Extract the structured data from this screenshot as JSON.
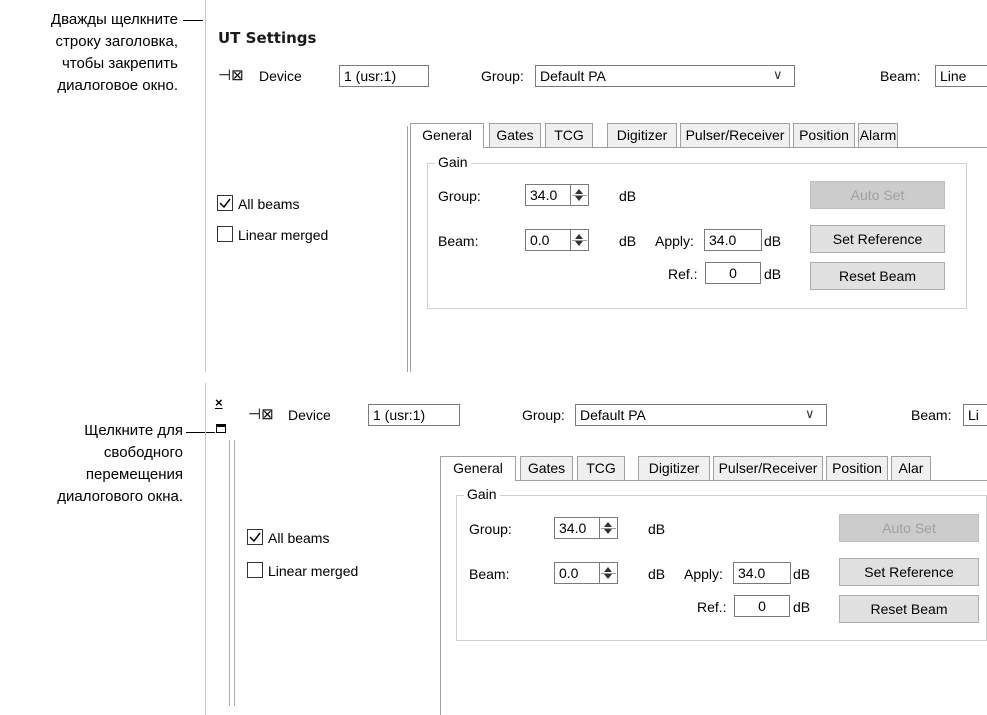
{
  "callouts": {
    "top": [
      "Дважды щелкните",
      "строку заголовка,",
      "чтобы закрепить",
      "диалоговое окно."
    ],
    "bottom": [
      "Щелкните для",
      "свободного",
      "перемещения",
      "диалогового окна."
    ]
  },
  "window": {
    "title": "UT Settings"
  },
  "toolbar": {
    "device_label": "Device",
    "device_value": "1 (usr:1)",
    "group_label": "Group:",
    "group_value": "Default PA",
    "beam_label": "Beam:",
    "beam_value_top": "Line",
    "beam_value_bottom": "Li"
  },
  "tabs": [
    "General",
    "Gates",
    "TCG",
    "Digitizer",
    "Pulser/Receiver",
    "Position",
    "Alarm",
    "Alar"
  ],
  "options": {
    "all_beams": "All beams",
    "linear_merged": "Linear merged"
  },
  "gain": {
    "legend": "Gain",
    "group_label": "Group:",
    "group_value": "34.0",
    "group_unit": "dB",
    "beam_label": "Beam:",
    "beam_value": "0.0",
    "beam_unit": "dB",
    "apply_label": "Apply:",
    "apply_value": "34.0",
    "apply_unit": "dB",
    "ref_label": "Ref.:",
    "ref_value": "0",
    "ref_unit": "dB"
  },
  "buttons": {
    "auto_set": "Auto Set",
    "set_reference": "Set Reference",
    "reset_beam": "Reset Beam"
  },
  "dock": {
    "close_glyph": "×"
  }
}
